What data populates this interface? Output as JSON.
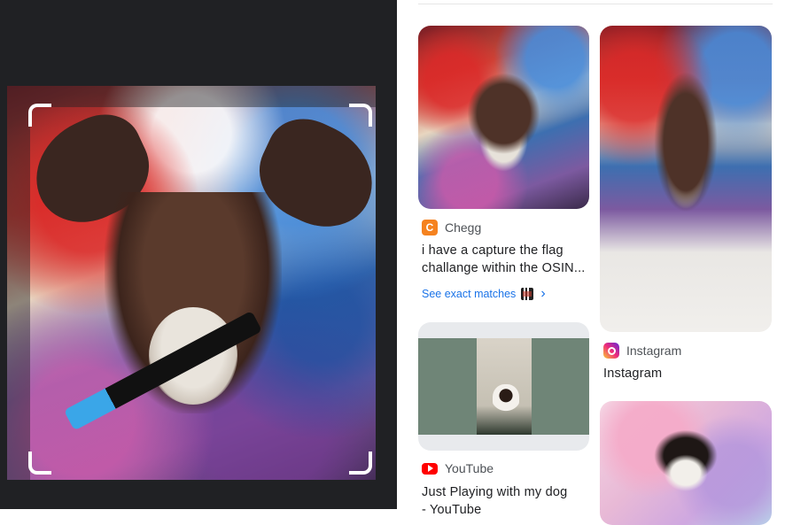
{
  "results": [
    {
      "source": "Chegg",
      "source_icon": "chegg-icon",
      "title_line1": "i have a capture the flag",
      "title_line2": "challange within the OSIN...",
      "exact_matches_label": "See exact matches",
      "chevron": "›"
    },
    {
      "source": "Instagram",
      "source_icon": "instagram-icon",
      "title": "Instagram"
    },
    {
      "source": "YouTube",
      "source_icon": "youtube-icon",
      "title_line1": "Just Playing with my dog",
      "title_line2": "- YouTube"
    }
  ],
  "colors": {
    "left_panel": "#202124",
    "link": "#1a73e8",
    "chegg": "#f5821f",
    "youtube": "#ff0000"
  }
}
